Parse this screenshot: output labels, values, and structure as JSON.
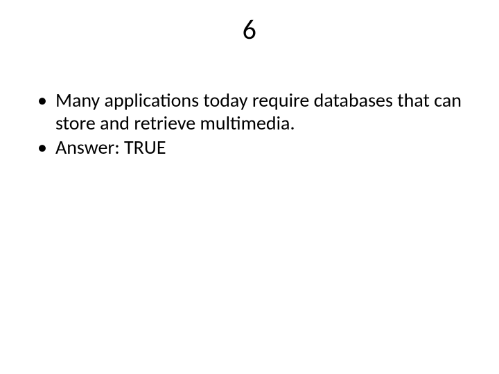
{
  "slide": {
    "title": "6",
    "bullets": [
      "Many applications today require databases that can store and retrieve multimedia.",
      "Answer:  TRUE"
    ]
  }
}
